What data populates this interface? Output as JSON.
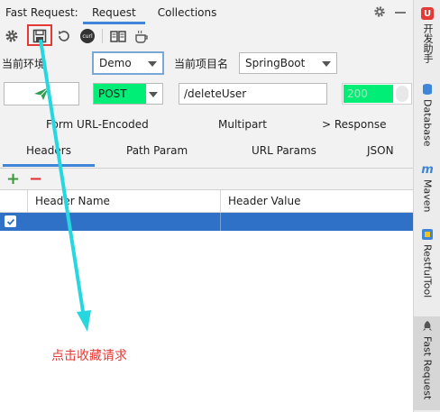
{
  "header": {
    "tool_title": "Fast Request:",
    "tabs": [
      {
        "label": "Request",
        "active": true
      },
      {
        "label": "Collections",
        "active": false
      }
    ]
  },
  "toolbar": {
    "icons": [
      "gear-icon",
      "save-icon",
      "refresh-icon",
      "curl-icon",
      "book-icon",
      "coffee-icon"
    ],
    "curl_text": "curl"
  },
  "env": {
    "env_label": "当前环境",
    "env_value": "Demo",
    "project_label": "当前项目名",
    "project_value": "SpringBoot"
  },
  "request": {
    "method": "POST",
    "url": "/deleteUser",
    "status": "200"
  },
  "subtabs_row1": [
    "Form URL-Encoded",
    "Multipart",
    "> Response"
  ],
  "subtabs_row2": [
    "Headers",
    "Path Param",
    "URL Params",
    "JSON"
  ],
  "table": {
    "columns": [
      "Header Name",
      "Header Value"
    ],
    "rows": [
      {
        "checked": true,
        "name": "",
        "value": ""
      }
    ]
  },
  "annotation": "点击收藏请求",
  "right_sidebar": [
    {
      "label": "开发助手",
      "icon": "U",
      "color": "#e53935"
    },
    {
      "label": "Database",
      "icon": "db-icon",
      "color": "#3f86d8"
    },
    {
      "label": "Maven",
      "icon": "m",
      "color": "#3f86d8"
    },
    {
      "label": "RestfulTool",
      "icon": "restful-icon",
      "color": "#3f86d8"
    },
    {
      "label": "Fast Request",
      "icon": "rocket-icon",
      "color": "#555555"
    }
  ]
}
